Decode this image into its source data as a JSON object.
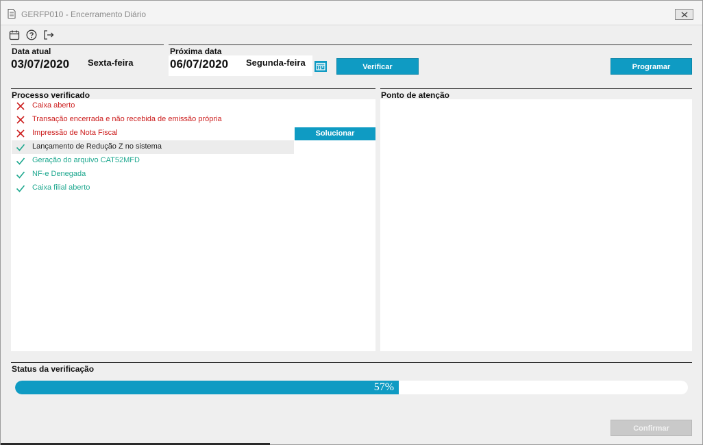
{
  "window": {
    "title": "GERFP010 - Encerramento Diário"
  },
  "toolbar": {
    "icons": [
      "calendar-icon",
      "help-icon",
      "exit-icon"
    ]
  },
  "dates": {
    "current_label": "Data atual",
    "current_date": "03/07/2020",
    "current_day": "Sexta-feira",
    "next_label": "Próxima data",
    "next_date": "06/07/2020",
    "next_day": "Segunda-feira"
  },
  "buttons": {
    "verify": "Verificar",
    "schedule": "Programar",
    "solve": "Solucionar",
    "confirm": "Confirmar"
  },
  "process": {
    "label": "Processo verificado",
    "items": [
      {
        "text": "Caixa aberto",
        "status": "fail"
      },
      {
        "text": "Transação encerrada e não recebida de emissão própria",
        "status": "fail"
      },
      {
        "text": "Impressão de Nota Fiscal",
        "status": "fail"
      },
      {
        "text": "Lançamento de Redução Z no sistema",
        "status": "ok"
      },
      {
        "text": "Geração do arquivo CAT52MFD",
        "status": "ok"
      },
      {
        "text": "NF-e Denegada",
        "status": "ok"
      },
      {
        "text": "Caixa filial aberto",
        "status": "ok"
      }
    ],
    "selected_index": 3
  },
  "attention": {
    "label": "Ponto de atenção"
  },
  "status": {
    "label": "Status da verificação",
    "progress_percent": 57,
    "progress_text": "57%"
  },
  "colors": {
    "accent": "#0f9bc3",
    "fail": "#cc1d1d",
    "ok": "#1ea88f"
  }
}
